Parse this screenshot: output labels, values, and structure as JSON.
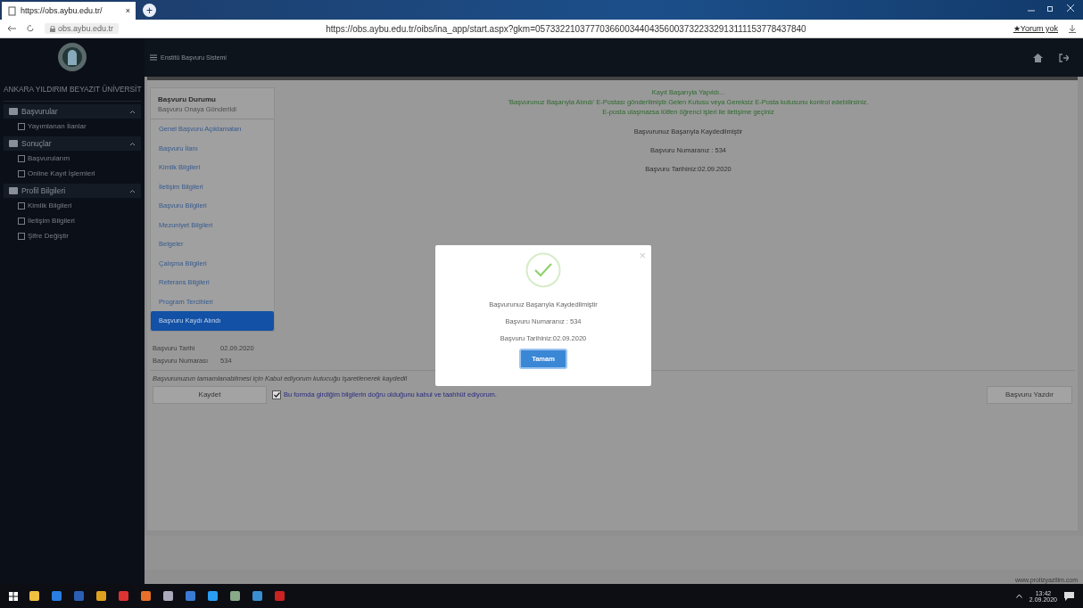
{
  "browser": {
    "tab_title": "https://obs.aybu.edu.tr/",
    "tab_close": "×",
    "new_tab": "+",
    "host": "obs.aybu.edu.tr",
    "url": "https://obs.aybu.edu.tr/oibs/ina_app/start.aspx?gkm=0573322103777036600344043560037322332913111153778437840",
    "bookmark": "★Yorum yok"
  },
  "header": {
    "title": "Enstitü Başvuru Sistemi"
  },
  "sidebar": {
    "university": "ANKARA YILDIRIM BEYAZIT ÜNİVERSİT",
    "sections": [
      {
        "label": "Başvurular",
        "expanded": true,
        "children": [
          {
            "label": "Yayımlanan İlanlar"
          }
        ]
      },
      {
        "label": "Sonuçlar",
        "expanded": true,
        "children": [
          {
            "label": "Başvurularım"
          },
          {
            "label": "Online Kayıt İşlemleri"
          }
        ]
      },
      {
        "label": "Profil Bilgileri",
        "expanded": true,
        "children": [
          {
            "label": "Kimlik Bilgileri"
          },
          {
            "label": "İletişim Bilgileri"
          },
          {
            "label": "Şifre Değiştir"
          }
        ]
      }
    ]
  },
  "steps": {
    "status_title": "Başvuru Durumu",
    "status": "Başvuru Onaya Gönderildi",
    "items": [
      {
        "label": "Genel Başvuru Açıklamaları",
        "selected": false
      },
      {
        "label": "Başvuru İlanı",
        "selected": false
      },
      {
        "label": "Kimlik Bilgileri",
        "selected": false
      },
      {
        "label": "İletişim Bilgileri",
        "selected": false
      },
      {
        "label": "Başvuru Bilgileri",
        "selected": false
      },
      {
        "label": "Mezuniyet Bilgileri",
        "selected": false
      },
      {
        "label": "Belgeler",
        "selected": false
      },
      {
        "label": "Çalışma Bilgileri",
        "selected": false
      },
      {
        "label": "Referans Bilgileri",
        "selected": false
      },
      {
        "label": "Program Tercihleri",
        "selected": false
      },
      {
        "label": "Başvuru Kaydı Alındı",
        "selected": true
      }
    ],
    "info": [
      {
        "label": "Başvuru Tarihi",
        "value": "02.09.2020"
      },
      {
        "label": "Başvuru Numarası",
        "value": "534"
      }
    ]
  },
  "messages": [
    "Kayıt Başarıyla Yapıldı...",
    "'Başvurunuz Başarıyla Alındı' E-Postası gönderilmiştir.Gelen Kutusu veya Gereksiz E-Posta kutusunu kontrol edebilirsiniz.",
    "E-posta ulaşmazsa lütfen öğrenci işleri ile iletişime geçiniz"
  ],
  "summary": [
    "Başvurunuz Başarıyla Kaydedilmiştir",
    "Başvuru Numaranız : 534",
    "Başvuru Tarihiniz:02.09.2020"
  ],
  "form": {
    "note": "Başvurunuzun tamamlanabilmesi için Kabul ediyorum kutucuğu işaretlenerek kaydedil",
    "save": "Kaydet",
    "consent": {
      "label": "Bu formda girdiğim bilgilerin doğru olduğunu kabul ve taahhüt ediyorum.",
      "checked": true
    },
    "print": "Başvuru Yazdır"
  },
  "footer": "www.prolizyazilim.com",
  "dialog": {
    "close": "×",
    "lines": [
      "Başvurunuz Başarıyla Kaydedilmiştir",
      "Başvuru Numaranız : 534",
      "Başvuru Tarihiniz:02.09.2020"
    ],
    "ok": "Tamam"
  },
  "taskbar": {
    "time": "13:42",
    "date": "2.09.2020"
  }
}
